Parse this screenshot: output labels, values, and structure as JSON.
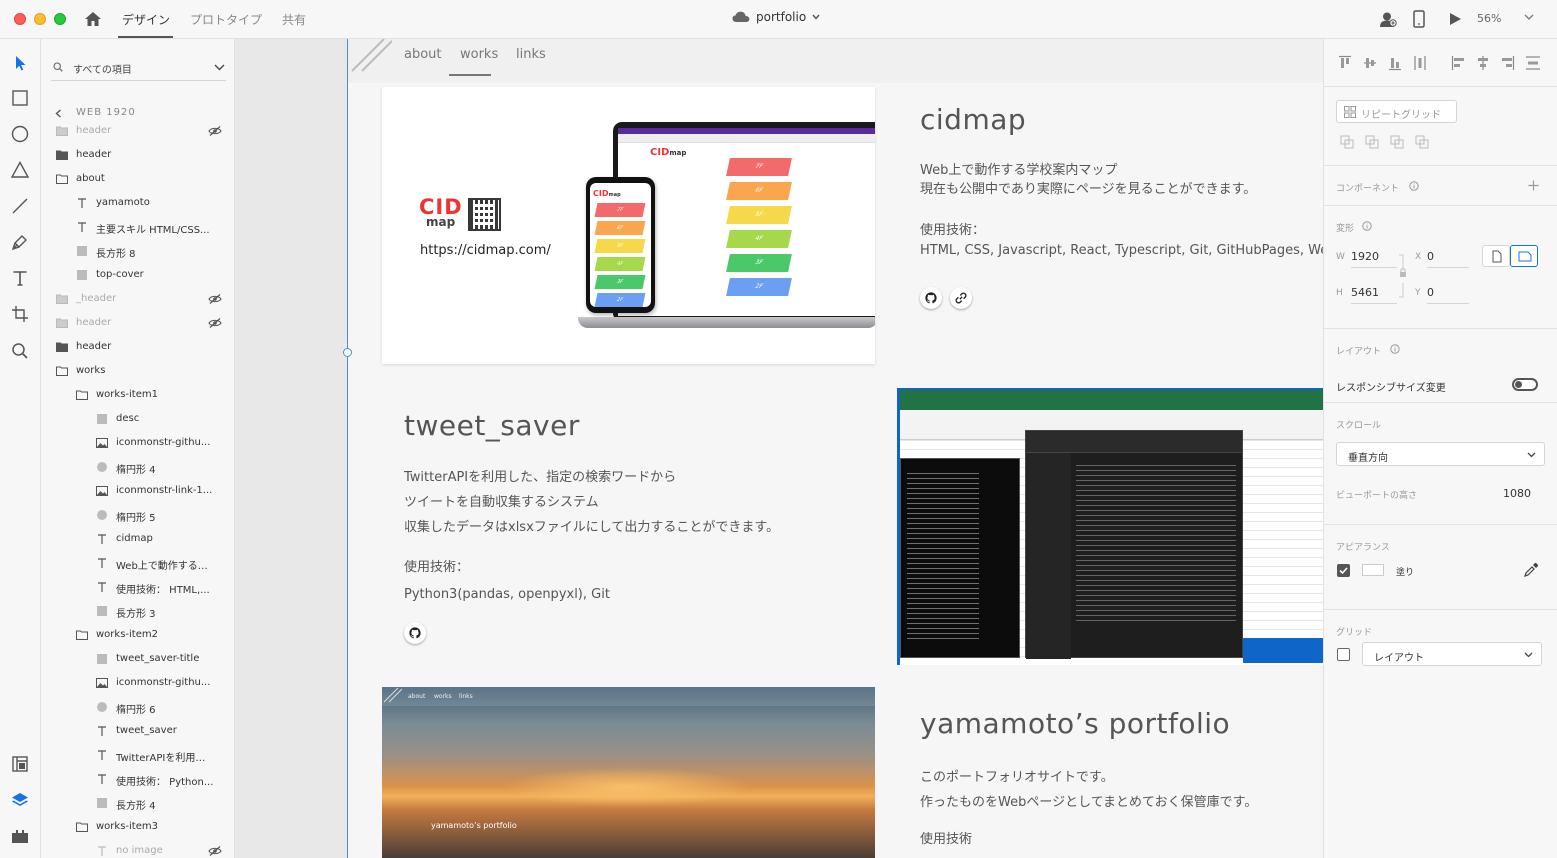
{
  "titlebar": {
    "tabs": [
      "デザイン",
      "プロトタイプ",
      "共有"
    ],
    "active_tab": "デザイン",
    "document_name": "portfolio",
    "zoom": "56%"
  },
  "layers": {
    "search_placeholder": "すべての項目",
    "breadcrumb": "WEB 1920",
    "items": [
      {
        "name": "header",
        "indent": 0,
        "type": "folder",
        "hidden": true
      },
      {
        "name": "header",
        "indent": 0,
        "type": "folder",
        "hidden": false
      },
      {
        "name": "about",
        "indent": 0,
        "type": "folder-open",
        "hidden": false
      },
      {
        "name": "yamamoto",
        "indent": 1,
        "type": "text",
        "hidden": false
      },
      {
        "name": "主要スキル HTML/CSS...",
        "indent": 1,
        "type": "text",
        "hidden": false
      },
      {
        "name": "長方形 8",
        "indent": 1,
        "type": "rect",
        "hidden": false
      },
      {
        "name": "top-cover",
        "indent": 1,
        "type": "rect",
        "hidden": false
      },
      {
        "name": "_header",
        "indent": 0,
        "type": "folder",
        "hidden": true
      },
      {
        "name": "header",
        "indent": 0,
        "type": "folder",
        "hidden": true
      },
      {
        "name": "header",
        "indent": 0,
        "type": "folder",
        "hidden": false
      },
      {
        "name": "works",
        "indent": 0,
        "type": "folder-open",
        "hidden": false
      },
      {
        "name": "works-item1",
        "indent": 1,
        "type": "folder-open",
        "hidden": false
      },
      {
        "name": "desc",
        "indent": 2,
        "type": "rect",
        "hidden": false
      },
      {
        "name": "iconmonstr-githu...",
        "indent": 2,
        "type": "image",
        "hidden": false
      },
      {
        "name": "楕円形 4",
        "indent": 2,
        "type": "ellipse",
        "hidden": false
      },
      {
        "name": "iconmonstr-link-1...",
        "indent": 2,
        "type": "image",
        "hidden": false
      },
      {
        "name": "楕円形 5",
        "indent": 2,
        "type": "ellipse",
        "hidden": false
      },
      {
        "name": "cidmap",
        "indent": 2,
        "type": "text",
        "hidden": false
      },
      {
        "name": "Web上で動作する…",
        "indent": 2,
        "type": "text",
        "hidden": false
      },
      {
        "name": "使用技術： HTML,...",
        "indent": 2,
        "type": "text",
        "hidden": false
      },
      {
        "name": "長方形 3",
        "indent": 2,
        "type": "rect",
        "hidden": false
      },
      {
        "name": "works-item2",
        "indent": 1,
        "type": "folder-open",
        "hidden": false
      },
      {
        "name": "tweet_saver-title",
        "indent": 2,
        "type": "rect",
        "hidden": false
      },
      {
        "name": "iconmonstr-githu...",
        "indent": 2,
        "type": "image",
        "hidden": false
      },
      {
        "name": "楕円形 6",
        "indent": 2,
        "type": "ellipse",
        "hidden": false
      },
      {
        "name": "tweet_saver",
        "indent": 2,
        "type": "text",
        "hidden": false
      },
      {
        "name": "TwitterAPIを利用…",
        "indent": 2,
        "type": "text",
        "hidden": false
      },
      {
        "name": "使用技術： Python...",
        "indent": 2,
        "type": "text",
        "hidden": false
      },
      {
        "name": "長方形 4",
        "indent": 2,
        "type": "rect",
        "hidden": false
      },
      {
        "name": "works-item3",
        "indent": 1,
        "type": "folder-open",
        "hidden": false
      },
      {
        "name": "no image",
        "indent": 2,
        "type": "text",
        "hidden": true
      }
    ]
  },
  "site": {
    "nav": [
      "about",
      "works",
      "links"
    ],
    "works": [
      {
        "title": "cidmap",
        "desc": [
          "Web上で動作する学校案内マップ",
          "現在も公開中であり実際にページを見ることができます。"
        ],
        "tech_label": "使用技術：",
        "tech": "HTML, CSS, Javascript, React, Typescript, Git, GitHubPages, Webpack",
        "logo_text": "CID",
        "logo_sub": "map",
        "url": "https://cidmap.com/",
        "floors": [
          "7F",
          "6F",
          "5F",
          "4F",
          "3F",
          "2F"
        ]
      },
      {
        "title": "tweet_saver",
        "desc": [
          "TwitterAPIを利用した、指定の検索ワードから",
          "ツイートを自動収集するシステム",
          "収集したデータはxlsxファイルにして出力することができます。"
        ],
        "tech_label": "使用技術：",
        "tech": "Python3(pandas, openpyxl), Git"
      },
      {
        "title": "yamamoto’s portfolio",
        "desc": [
          "このポートフォリオサイトです。",
          "作ったものをWebページとしてまとめておく保管庫です。"
        ],
        "tech_label": "使用技術",
        "thumb_nav": [
          "about",
          "works",
          "links"
        ],
        "thumb_caption": "yamamoto’s portfolio"
      }
    ]
  },
  "properties": {
    "repeat_grid": "リピートグリッド",
    "component_label": "コンポーネント",
    "transform_label": "変形",
    "w_label": "W",
    "w": "1920",
    "h_label": "H",
    "h": "5461",
    "x_label": "X",
    "x": "0",
    "y_label": "Y",
    "y": "0",
    "layout_label": "レイアウト",
    "responsive_label": "レスポンシブサイズ変更",
    "responsive_on": false,
    "scroll_label": "スクロール",
    "scroll_value": "垂直方向",
    "viewport_label": "ビューポートの高さ",
    "viewport_value": "1080",
    "appearance_label": "アピアランス",
    "fill_label": "塗り",
    "fill_checked": true,
    "grid_label": "グリッド",
    "grid_value": "レイアウト",
    "grid_checked": false
  },
  "colors": {
    "accent": "#1473e6",
    "tool_active": "#1473e6",
    "layers_active": "#1473e6"
  }
}
